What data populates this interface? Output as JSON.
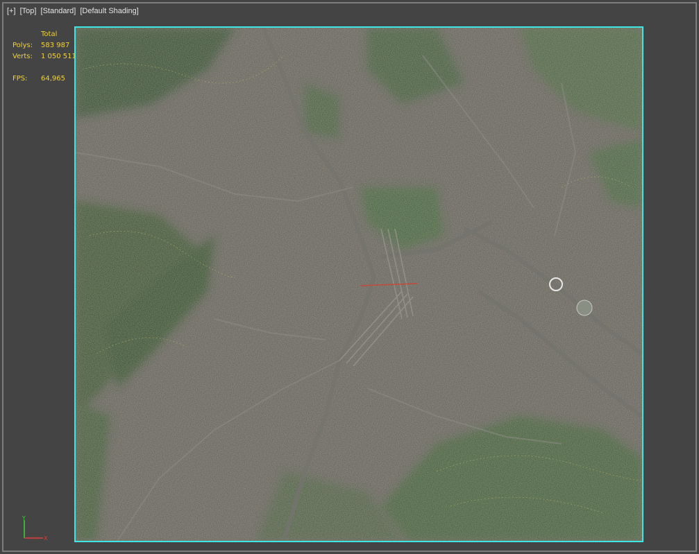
{
  "viewport": {
    "labels": [
      "[+]",
      "[Top]",
      "[Standard]",
      "[Default Shading]"
    ]
  },
  "stats": {
    "header": "Total",
    "polys_label": "Polys:",
    "polys_value": "583 987",
    "verts_label": "Verts:",
    "verts_value": "1 050 511",
    "fps_label": "FPS:",
    "fps_value": "64,965"
  },
  "colors": {
    "viewport_bg": "#444444",
    "stats_text": "#f0d23c",
    "selection_frame": "#3fe6e6",
    "label_text": "#e6e6e6"
  },
  "gizmo": {
    "y_axis": "Y",
    "x_axis": "X"
  }
}
